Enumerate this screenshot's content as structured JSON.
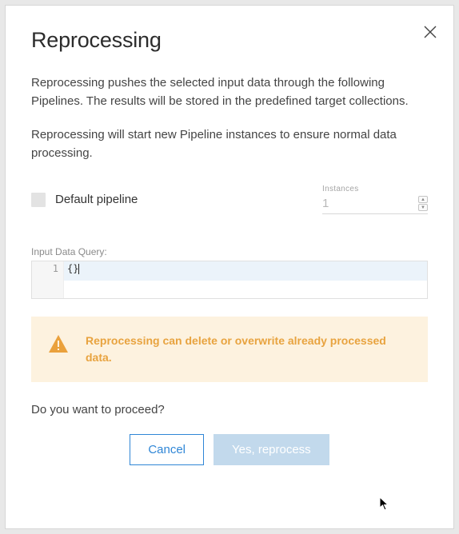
{
  "dialog": {
    "title": "Reprocessing",
    "description1": "Reprocessing pushes the selected input data through the following Pipelines. The results will be stored in the predefined target collections.",
    "description2": "Reprocessing will start new Pipeline instances to ensure normal data processing.",
    "pipeline": {
      "checkbox_label": "Default pipeline",
      "checkbox_checked": false,
      "instances_label": "Instances",
      "instances_value": "1"
    },
    "query": {
      "label": "Input Data Query:",
      "line_number": "1",
      "code": "{}"
    },
    "warning": {
      "text": "Reprocessing can delete or overwrite already processed data."
    },
    "proceed_text": "Do you want to proceed?",
    "buttons": {
      "cancel": "Cancel",
      "confirm": "Yes, reprocess"
    }
  }
}
